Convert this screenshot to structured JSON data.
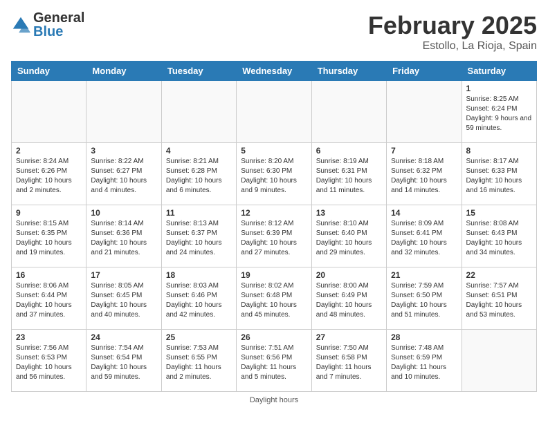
{
  "header": {
    "logo_general": "General",
    "logo_blue": "Blue",
    "month_year": "February 2025",
    "location": "Estollo, La Rioja, Spain"
  },
  "days_of_week": [
    "Sunday",
    "Monday",
    "Tuesday",
    "Wednesday",
    "Thursday",
    "Friday",
    "Saturday"
  ],
  "weeks": [
    [
      {
        "num": "",
        "info": ""
      },
      {
        "num": "",
        "info": ""
      },
      {
        "num": "",
        "info": ""
      },
      {
        "num": "",
        "info": ""
      },
      {
        "num": "",
        "info": ""
      },
      {
        "num": "",
        "info": ""
      },
      {
        "num": "1",
        "info": "Sunrise: 8:25 AM\nSunset: 6:24 PM\nDaylight: 9 hours and 59 minutes."
      }
    ],
    [
      {
        "num": "2",
        "info": "Sunrise: 8:24 AM\nSunset: 6:26 PM\nDaylight: 10 hours and 2 minutes."
      },
      {
        "num": "3",
        "info": "Sunrise: 8:22 AM\nSunset: 6:27 PM\nDaylight: 10 hours and 4 minutes."
      },
      {
        "num": "4",
        "info": "Sunrise: 8:21 AM\nSunset: 6:28 PM\nDaylight: 10 hours and 6 minutes."
      },
      {
        "num": "5",
        "info": "Sunrise: 8:20 AM\nSunset: 6:30 PM\nDaylight: 10 hours and 9 minutes."
      },
      {
        "num": "6",
        "info": "Sunrise: 8:19 AM\nSunset: 6:31 PM\nDaylight: 10 hours and 11 minutes."
      },
      {
        "num": "7",
        "info": "Sunrise: 8:18 AM\nSunset: 6:32 PM\nDaylight: 10 hours and 14 minutes."
      },
      {
        "num": "8",
        "info": "Sunrise: 8:17 AM\nSunset: 6:33 PM\nDaylight: 10 hours and 16 minutes."
      }
    ],
    [
      {
        "num": "9",
        "info": "Sunrise: 8:15 AM\nSunset: 6:35 PM\nDaylight: 10 hours and 19 minutes."
      },
      {
        "num": "10",
        "info": "Sunrise: 8:14 AM\nSunset: 6:36 PM\nDaylight: 10 hours and 21 minutes."
      },
      {
        "num": "11",
        "info": "Sunrise: 8:13 AM\nSunset: 6:37 PM\nDaylight: 10 hours and 24 minutes."
      },
      {
        "num": "12",
        "info": "Sunrise: 8:12 AM\nSunset: 6:39 PM\nDaylight: 10 hours and 27 minutes."
      },
      {
        "num": "13",
        "info": "Sunrise: 8:10 AM\nSunset: 6:40 PM\nDaylight: 10 hours and 29 minutes."
      },
      {
        "num": "14",
        "info": "Sunrise: 8:09 AM\nSunset: 6:41 PM\nDaylight: 10 hours and 32 minutes."
      },
      {
        "num": "15",
        "info": "Sunrise: 8:08 AM\nSunset: 6:43 PM\nDaylight: 10 hours and 34 minutes."
      }
    ],
    [
      {
        "num": "16",
        "info": "Sunrise: 8:06 AM\nSunset: 6:44 PM\nDaylight: 10 hours and 37 minutes."
      },
      {
        "num": "17",
        "info": "Sunrise: 8:05 AM\nSunset: 6:45 PM\nDaylight: 10 hours and 40 minutes."
      },
      {
        "num": "18",
        "info": "Sunrise: 8:03 AM\nSunset: 6:46 PM\nDaylight: 10 hours and 42 minutes."
      },
      {
        "num": "19",
        "info": "Sunrise: 8:02 AM\nSunset: 6:48 PM\nDaylight: 10 hours and 45 minutes."
      },
      {
        "num": "20",
        "info": "Sunrise: 8:00 AM\nSunset: 6:49 PM\nDaylight: 10 hours and 48 minutes."
      },
      {
        "num": "21",
        "info": "Sunrise: 7:59 AM\nSunset: 6:50 PM\nDaylight: 10 hours and 51 minutes."
      },
      {
        "num": "22",
        "info": "Sunrise: 7:57 AM\nSunset: 6:51 PM\nDaylight: 10 hours and 53 minutes."
      }
    ],
    [
      {
        "num": "23",
        "info": "Sunrise: 7:56 AM\nSunset: 6:53 PM\nDaylight: 10 hours and 56 minutes."
      },
      {
        "num": "24",
        "info": "Sunrise: 7:54 AM\nSunset: 6:54 PM\nDaylight: 10 hours and 59 minutes."
      },
      {
        "num": "25",
        "info": "Sunrise: 7:53 AM\nSunset: 6:55 PM\nDaylight: 11 hours and 2 minutes."
      },
      {
        "num": "26",
        "info": "Sunrise: 7:51 AM\nSunset: 6:56 PM\nDaylight: 11 hours and 5 minutes."
      },
      {
        "num": "27",
        "info": "Sunrise: 7:50 AM\nSunset: 6:58 PM\nDaylight: 11 hours and 7 minutes."
      },
      {
        "num": "28",
        "info": "Sunrise: 7:48 AM\nSunset: 6:59 PM\nDaylight: 11 hours and 10 minutes."
      },
      {
        "num": "",
        "info": ""
      }
    ]
  ],
  "footer": {
    "daylight_hours_label": "Daylight hours"
  }
}
